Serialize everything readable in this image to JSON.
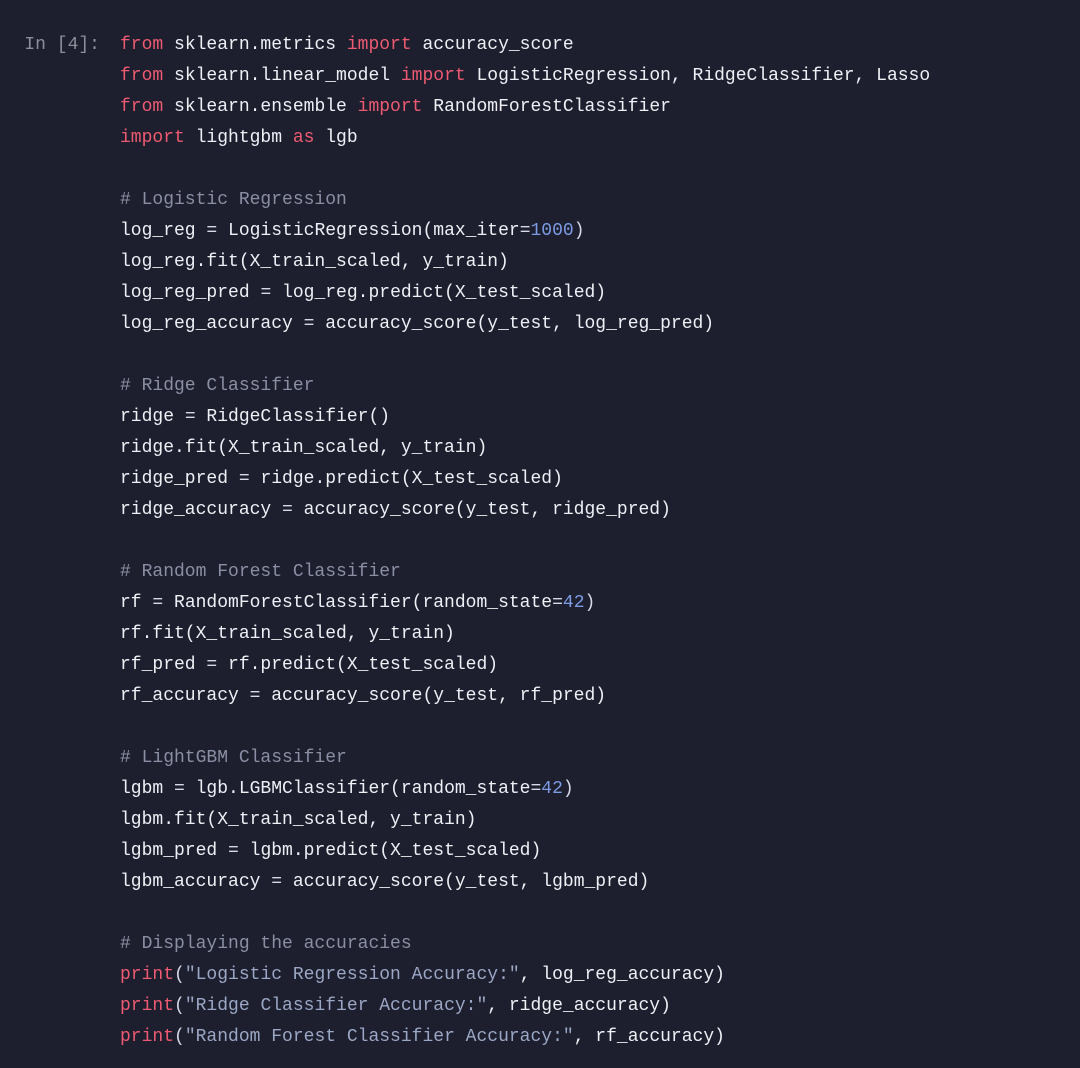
{
  "prompt": "In [4]:",
  "code": {
    "lines": [
      [
        {
          "t": "from ",
          "c": "c-keyword"
        },
        {
          "t": "sklearn.metrics ",
          "c": "c-module"
        },
        {
          "t": "import ",
          "c": "c-keyword"
        },
        {
          "t": "accuracy_score",
          "c": "c-id"
        }
      ],
      [
        {
          "t": "from ",
          "c": "c-keyword"
        },
        {
          "t": "sklearn.linear_model ",
          "c": "c-module"
        },
        {
          "t": "import ",
          "c": "c-keyword"
        },
        {
          "t": "LogisticRegression, RidgeClassifier, Lasso",
          "c": "c-id"
        }
      ],
      [
        {
          "t": "from ",
          "c": "c-keyword"
        },
        {
          "t": "sklearn.ensemble ",
          "c": "c-module"
        },
        {
          "t": "import ",
          "c": "c-keyword"
        },
        {
          "t": "RandomForestClassifier",
          "c": "c-id"
        }
      ],
      [
        {
          "t": "import ",
          "c": "c-keyword"
        },
        {
          "t": "lightgbm ",
          "c": "c-module"
        },
        {
          "t": "as ",
          "c": "c-keyword"
        },
        {
          "t": "lgb",
          "c": "c-id"
        }
      ],
      [],
      [
        {
          "t": "# Logistic Regression",
          "c": "c-comment"
        }
      ],
      [
        {
          "t": "log_reg ",
          "c": "c-id"
        },
        {
          "t": "= ",
          "c": "c-punct"
        },
        {
          "t": "LogisticRegression(max_iter",
          "c": "c-id"
        },
        {
          "t": "=",
          "c": "c-punct"
        },
        {
          "t": "1000",
          "c": "c-number"
        },
        {
          "t": ")",
          "c": "c-punct"
        }
      ],
      [
        {
          "t": "log_reg.fit(X_train_scaled, y_train)",
          "c": "c-id"
        }
      ],
      [
        {
          "t": "log_reg_pred ",
          "c": "c-id"
        },
        {
          "t": "= ",
          "c": "c-punct"
        },
        {
          "t": "log_reg.predict(X_test_scaled)",
          "c": "c-id"
        }
      ],
      [
        {
          "t": "log_reg_accuracy ",
          "c": "c-id"
        },
        {
          "t": "= ",
          "c": "c-punct"
        },
        {
          "t": "accuracy_score(y_test, log_reg_pred)",
          "c": "c-id"
        }
      ],
      [],
      [
        {
          "t": "# Ridge Classifier",
          "c": "c-comment"
        }
      ],
      [
        {
          "t": "ridge ",
          "c": "c-id"
        },
        {
          "t": "= ",
          "c": "c-punct"
        },
        {
          "t": "RidgeClassifier()",
          "c": "c-id"
        }
      ],
      [
        {
          "t": "ridge.fit(X_train_scaled, y_train)",
          "c": "c-id"
        }
      ],
      [
        {
          "t": "ridge_pred ",
          "c": "c-id"
        },
        {
          "t": "= ",
          "c": "c-punct"
        },
        {
          "t": "ridge.predict(X_test_scaled)",
          "c": "c-id"
        }
      ],
      [
        {
          "t": "ridge_accuracy ",
          "c": "c-id"
        },
        {
          "t": "= ",
          "c": "c-punct"
        },
        {
          "t": "accuracy_score(y_test, ridge_pred)",
          "c": "c-id"
        }
      ],
      [],
      [
        {
          "t": "# Random Forest Classifier",
          "c": "c-comment"
        }
      ],
      [
        {
          "t": "rf ",
          "c": "c-id"
        },
        {
          "t": "= ",
          "c": "c-punct"
        },
        {
          "t": "RandomForestClassifier(random_state",
          "c": "c-id"
        },
        {
          "t": "=",
          "c": "c-punct"
        },
        {
          "t": "42",
          "c": "c-number"
        },
        {
          "t": ")",
          "c": "c-punct"
        }
      ],
      [
        {
          "t": "rf.fit(X_train_scaled, y_train)",
          "c": "c-id"
        }
      ],
      [
        {
          "t": "rf_pred ",
          "c": "c-id"
        },
        {
          "t": "= ",
          "c": "c-punct"
        },
        {
          "t": "rf.predict(X_test_scaled)",
          "c": "c-id"
        }
      ],
      [
        {
          "t": "rf_accuracy ",
          "c": "c-id"
        },
        {
          "t": "= ",
          "c": "c-punct"
        },
        {
          "t": "accuracy_score(y_test, rf_pred)",
          "c": "c-id"
        }
      ],
      [],
      [
        {
          "t": "# LightGBM Classifier",
          "c": "c-comment"
        }
      ],
      [
        {
          "t": "lgbm ",
          "c": "c-id"
        },
        {
          "t": "= ",
          "c": "c-punct"
        },
        {
          "t": "lgb.LGBMClassifier(random_state",
          "c": "c-id"
        },
        {
          "t": "=",
          "c": "c-punct"
        },
        {
          "t": "42",
          "c": "c-number"
        },
        {
          "t": ")",
          "c": "c-punct"
        }
      ],
      [
        {
          "t": "lgbm.fit(X_train_scaled, y_train)",
          "c": "c-id"
        }
      ],
      [
        {
          "t": "lgbm_pred ",
          "c": "c-id"
        },
        {
          "t": "= ",
          "c": "c-punct"
        },
        {
          "t": "lgbm.predict(X_test_scaled)",
          "c": "c-id"
        }
      ],
      [
        {
          "t": "lgbm_accuracy ",
          "c": "c-id"
        },
        {
          "t": "= ",
          "c": "c-punct"
        },
        {
          "t": "accuracy_score(y_test, lgbm_pred)",
          "c": "c-id"
        }
      ],
      [],
      [
        {
          "t": "# Displaying the accuracies",
          "c": "c-comment"
        }
      ],
      [
        {
          "t": "print",
          "c": "c-builtin"
        },
        {
          "t": "(",
          "c": "c-punct"
        },
        {
          "t": "\"Logistic Regression Accuracy:\"",
          "c": "c-string"
        },
        {
          "t": ", log_reg_accuracy)",
          "c": "c-id"
        }
      ],
      [
        {
          "t": "print",
          "c": "c-builtin"
        },
        {
          "t": "(",
          "c": "c-punct"
        },
        {
          "t": "\"Ridge Classifier Accuracy:\"",
          "c": "c-string"
        },
        {
          "t": ", ridge_accuracy)",
          "c": "c-id"
        }
      ],
      [
        {
          "t": "print",
          "c": "c-builtin"
        },
        {
          "t": "(",
          "c": "c-punct"
        },
        {
          "t": "\"Random Forest Classifier Accuracy:\"",
          "c": "c-string"
        },
        {
          "t": ", rf_accuracy)",
          "c": "c-id"
        }
      ]
    ]
  }
}
